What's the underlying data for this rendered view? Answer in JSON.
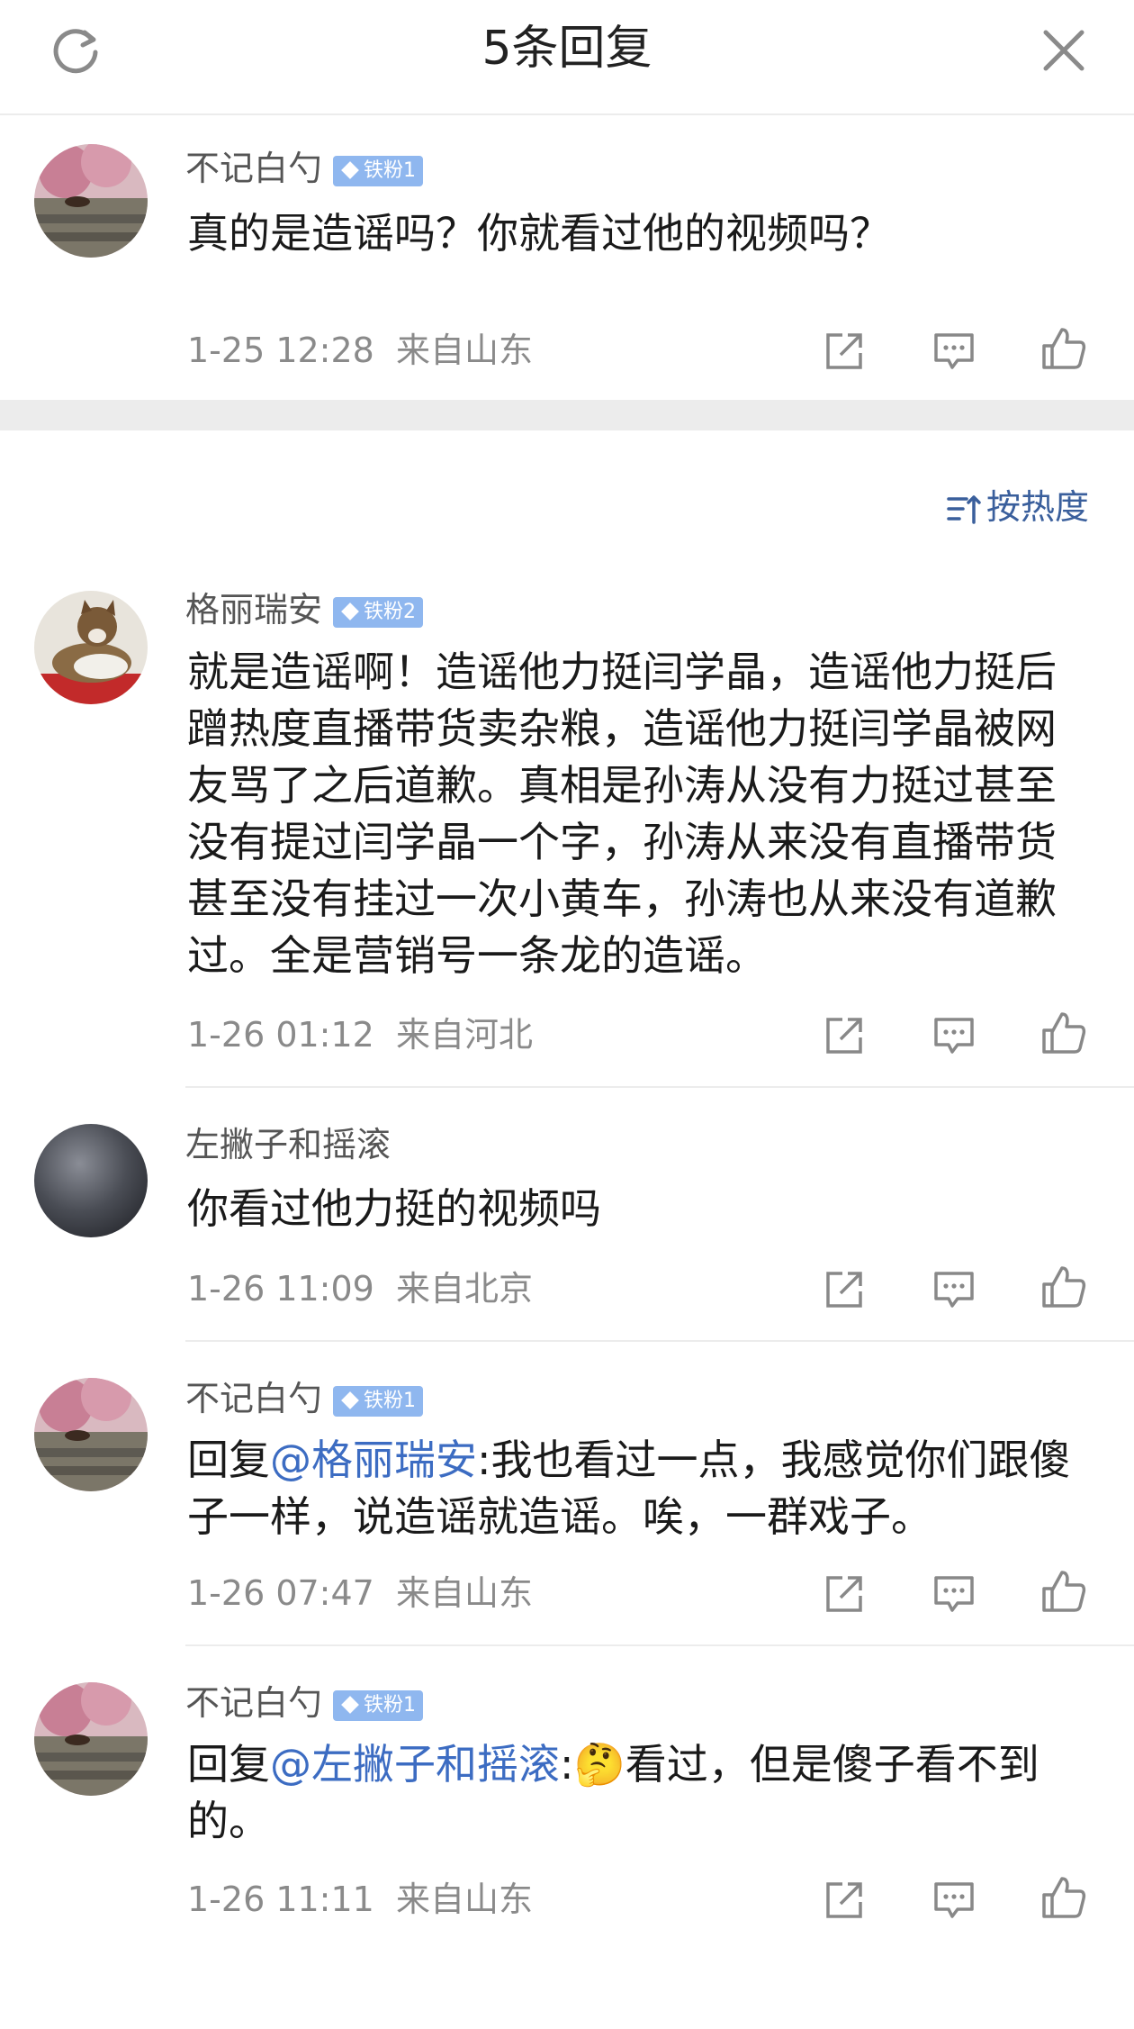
{
  "header": {
    "title": "5条回复",
    "refresh_icon": "refresh-icon",
    "close_icon": "close-icon"
  },
  "main_comment": {
    "author": "不记白勺",
    "badge": "铁粉1",
    "text": "真的是造谣吗？你就看过他的视频吗？",
    "time": "1-25 12:28",
    "location": "来自山东"
  },
  "sort": {
    "label": "按热度",
    "icon": "sort-icon"
  },
  "replies": [
    {
      "author": "格丽瑞安",
      "badge": "铁粉2",
      "text": "就是造谣啊！造谣他力挺闫学晶，造谣他力挺后蹭热度直播带货卖杂粮，造谣他力挺闫学晶被网友骂了之后道歉。真相是孙涛从没有力挺过甚至没有提过闫学晶一个字，孙涛从来没有直播带货甚至没有挂过一次小黄车，孙涛也从来没有道歉过。全是营销号一条龙的造谣。",
      "time": "1-26 01:12",
      "location": "来自河北"
    },
    {
      "author": "左撇子和摇滚",
      "badge": "",
      "text": "你看过他力挺的视频吗",
      "time": "1-26 11:09",
      "location": "来自北京"
    },
    {
      "author": "不记白勺",
      "badge": "铁粉1",
      "prefix": "回复",
      "mention": "@格丽瑞安",
      "text": ":我也看过一点，我感觉你们跟傻子一样，说造谣就造谣。唉，一群戏子。",
      "time": "1-26 07:47",
      "location": "来自山东"
    },
    {
      "author": "不记白勺",
      "badge": "铁粉1",
      "prefix": "回复",
      "mention": "@左撇子和摇滚",
      "emoji": "🤔",
      "text": "看过，但是傻子看不到的。",
      "separator": ":",
      "time": "1-26 11:11",
      "location": "来自山东"
    }
  ],
  "action_icons": [
    "share-icon",
    "comment-icon",
    "like-icon"
  ]
}
